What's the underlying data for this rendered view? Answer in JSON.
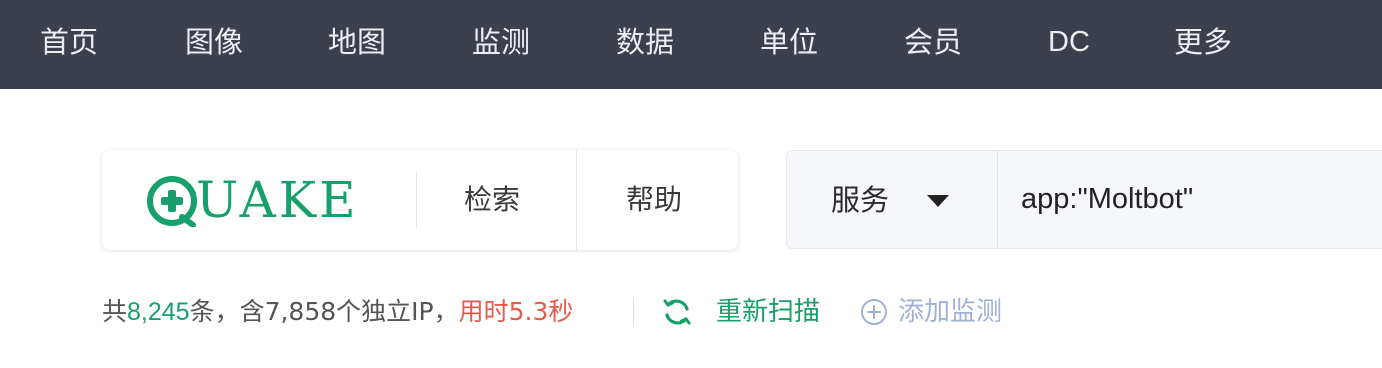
{
  "nav": {
    "items": [
      {
        "label": "首页"
      },
      {
        "label": "图像"
      },
      {
        "label": "地图"
      },
      {
        "label": "监测"
      },
      {
        "label": "数据"
      },
      {
        "label": "单位"
      },
      {
        "label": "会员"
      },
      {
        "label": "DC"
      },
      {
        "label": "更多"
      }
    ]
  },
  "logo": {
    "text": "UAKE",
    "icon": "plus-circle-icon",
    "color": "#17a06b"
  },
  "card_links": {
    "search": "检索",
    "help": "帮助"
  },
  "search": {
    "type_label": "服务",
    "dropdown_icon": "caret-down-icon",
    "query": "app:\"Moltbot\""
  },
  "stats": {
    "prefix": "共",
    "count": "8,245",
    "mid": "条，含7,858个独立IP，",
    "time_label": "用时5.3秒"
  },
  "actions": {
    "rescan_icon": "refresh-icon",
    "rescan_label": "重新扫描",
    "add_icon": "plus-circle-outline-icon",
    "add_label": "添加监测"
  },
  "colors": {
    "nav_bg": "#3c404c",
    "accent_green": "#17a06b",
    "time_red": "#e55a4a",
    "add_blue": "#9fb2d6"
  }
}
